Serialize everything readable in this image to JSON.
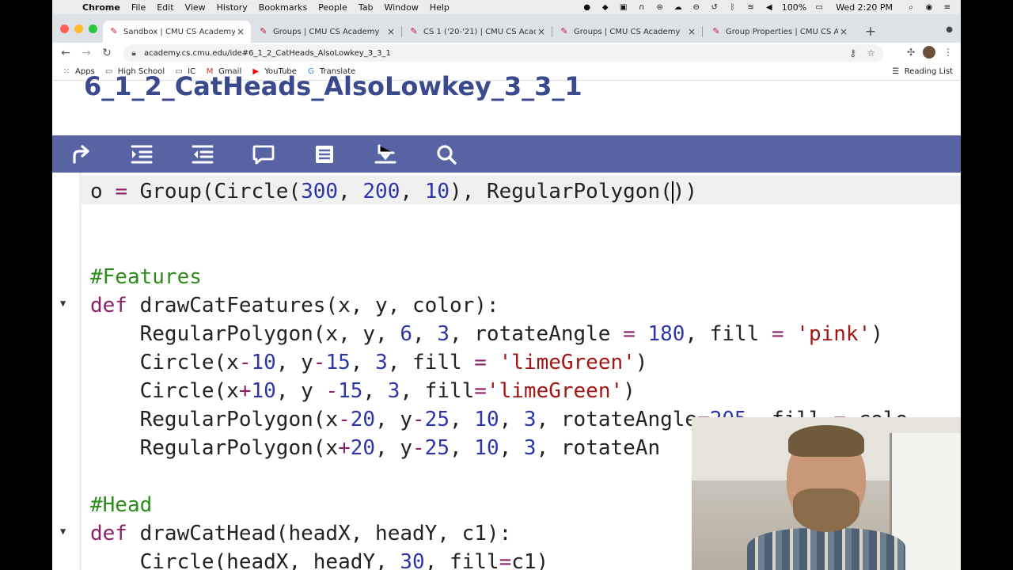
{
  "menubar": {
    "apple": "",
    "app": "Chrome",
    "items": [
      "File",
      "Edit",
      "View",
      "History",
      "Bookmarks",
      "People",
      "Tab",
      "Window",
      "Help"
    ],
    "battery": "100%",
    "clock": "Wed 2:20 PM"
  },
  "tabs": [
    {
      "label": "Sandbox | CMU CS Academy",
      "active": true
    },
    {
      "label": "Groups | CMU CS Academy",
      "active": false
    },
    {
      "label": "CS 1 ('20-'21) | CMU CS Acade",
      "active": false
    },
    {
      "label": "Groups | CMU CS Academy",
      "active": false
    },
    {
      "label": "Group Properties | CMU CS Ac",
      "active": false
    }
  ],
  "toolbar": {
    "url": "academy.cs.cmu.edu/ide#6_1_2_CatHeads_AlsoLowkey_3_3_1"
  },
  "bookmarks": {
    "items": [
      "Apps",
      "High School",
      "IC",
      "Gmail",
      "YouTube",
      "Translate"
    ],
    "reading_list": "Reading List"
  },
  "page": {
    "title": "6_1_2_CatHeads_AlsoLowkey_3_3_1"
  },
  "editor_tools": [
    "redo-icon",
    "indent-icon",
    "outdent-icon",
    "comment-icon",
    "format-icon",
    "wrap-icon",
    "search-icon"
  ],
  "code": {
    "l1_a": "o ",
    "l1_op": "=",
    "l1_b": " Group(Circle(",
    "l1_n1": "300",
    "l1_c1": ", ",
    "l1_n2": "200",
    "l1_c2": ", ",
    "l1_n3": "10",
    "l1_c3": "), RegularPolygon(",
    "l1_c4": "))",
    "l2": "#Features",
    "l3_k": "def",
    "l3_b": " drawCatFeatures(x, y, color):",
    "l4_a": "    RegularPolygon(x, y, ",
    "l4_n1": "6",
    "l4_c1": ", ",
    "l4_n2": "3",
    "l4_c2": ", rotateAngle ",
    "l4_op1": "=",
    "l4_c3": " ",
    "l4_n3": "180",
    "l4_c4": ", fill ",
    "l4_op2": "=",
    "l4_c5": " ",
    "l4_s": "'pink'",
    "l4_c6": ")",
    "l5_a": "    Circle(x",
    "l5_op1": "-",
    "l5_n1": "10",
    "l5_c1": ", y",
    "l5_op2": "-",
    "l5_n2": "15",
    "l5_c2": ", ",
    "l5_n3": "3",
    "l5_c3": ", fill ",
    "l5_op3": "=",
    "l5_c4": " ",
    "l5_s": "'limeGreen'",
    "l5_c5": ")",
    "l6_a": "    Circle(x",
    "l6_op1": "+",
    "l6_n1": "10",
    "l6_c1": ", y ",
    "l6_op2": "-",
    "l6_n2": "15",
    "l6_c2": ", ",
    "l6_n3": "3",
    "l6_c3": ", fill",
    "l6_op3": "=",
    "l6_s": "'limeGreen'",
    "l6_c4": ")",
    "l7_a": "    RegularPolygon(x",
    "l7_op1": "-",
    "l7_n1": "20",
    "l7_c1": ", y",
    "l7_op2": "-",
    "l7_n2": "25",
    "l7_c2": ", ",
    "l7_n3": "10",
    "l7_c3": ", ",
    "l7_n4": "3",
    "l7_c4": ", rotateAngle",
    "l7_op3": "=",
    "l7_n5": "205",
    "l7_c5": ", fill ",
    "l7_op4": "=",
    "l7_c6": " colo",
    "l8_a": "    RegularPolygon(x",
    "l8_op1": "+",
    "l8_n1": "20",
    "l8_c1": ", y",
    "l8_op2": "-",
    "l8_n2": "25",
    "l8_c2": ", ",
    "l8_n3": "10",
    "l8_c3": ", ",
    "l8_n4": "3",
    "l8_c4": ", rotateAn",
    "l9": "#Head",
    "l10_k": "def",
    "l10_b": " drawCatHead(headX, headY, c1):",
    "l11_a": "    Circle(headX, headY, ",
    "l11_n1": "30",
    "l11_c1": ", fill",
    "l11_op": "=",
    "l11_c2": "c1)"
  },
  "colors": {
    "editor_bar": "#5763a3",
    "title": "#3b4a8c",
    "keyword": "#8b1f6a",
    "number": "#2d36a8",
    "string": "#a31515",
    "comment": "#2e8b1e"
  }
}
